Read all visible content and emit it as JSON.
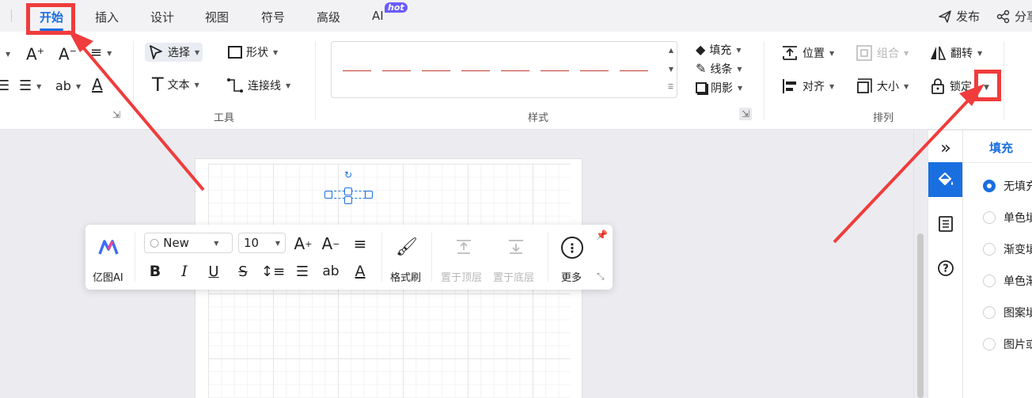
{
  "tabs": [
    {
      "label": "开始",
      "active": true
    },
    {
      "label": "插入"
    },
    {
      "label": "设计"
    },
    {
      "label": "视图"
    },
    {
      "label": "符号"
    },
    {
      "label": "高级"
    },
    {
      "label": "AI",
      "badge": "hot"
    }
  ],
  "top_actions": {
    "publish": "发布",
    "share": "分享"
  },
  "ribbon": {
    "tools": {
      "select": "选择",
      "shape": "形状",
      "text": "文本",
      "connector": "连接线",
      "group_label": "工具"
    },
    "style": {
      "fill": "填充",
      "line": "线条",
      "shadow": "阴影",
      "group_label": "样式"
    },
    "arrange": {
      "position": "位置",
      "group": "组合",
      "flip": "翻转",
      "align": "对齐",
      "size": "大小",
      "lock": "锁定",
      "group_label": "排列"
    }
  },
  "floating_toolbar": {
    "ai_label": "亿图AI",
    "font_name": "Times New Roman",
    "font_size": "10",
    "format_painter": "格式刷",
    "bring_to_top": "置于顶层",
    "send_to_bottom": "置于底层",
    "more": "更多"
  },
  "panel": {
    "title": "填充",
    "options": [
      {
        "label": "无填充",
        "selected": true
      },
      {
        "label": "单色填充"
      },
      {
        "label": "渐变填充"
      },
      {
        "label": "单色渐变填充"
      },
      {
        "label": "图案填充"
      },
      {
        "label": "图片或纹理填充"
      }
    ]
  },
  "colors": {
    "accent": "#1a6fe0",
    "annotation": "#f03c3c",
    "hot_badge": "#6b5cff",
    "style_line": "#c0392b"
  }
}
